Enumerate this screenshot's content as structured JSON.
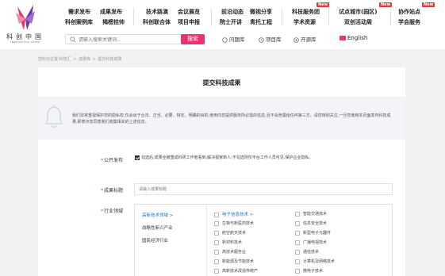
{
  "logo": {
    "cn": "科创中国",
    "en": "INNOVATION CHINA"
  },
  "nav": {
    "row1": [
      "需求发布",
      "成果发布",
      "技术路演",
      "会议展览",
      "前沿动态",
      "微视分享",
      "科技服务团",
      "试点城市(园区)",
      "协作站点"
    ],
    "row2": [
      "科创案例库",
      "揭榜挂帅",
      "科创联合体",
      "项目申报",
      "院士开讲",
      "青托工程",
      "学术资源",
      "双创活动周",
      "学会服务"
    ],
    "new_badge": "New"
  },
  "search": {
    "placeholder": "请输入搜索关键词...",
    "button": "搜索"
  },
  "quick_links": {
    "experts": "问题库",
    "projects": "项目库",
    "open": "开源库",
    "english": "English"
  },
  "breadcrumb": [
    "您所在位置:科技汇",
    ">",
    "成果库",
    ">",
    "提交科技成果"
  ],
  "page_title": "提交科技成果",
  "notice": "我们非常重视保护您的隐私权,仅会出于合法、正当、必要、特定、明确的目的,使用向您提供服务所必需的信息,且不会泄露给任何第三方。请您特别关注,一旦您使用本页面发布科技成果,即表示您同意我们收集相关的上述信息。",
  "form": {
    "public_label": "公开发布",
    "public_desc": "勾选后,成果全被重成科研工作者看到,解决视家新人;不勾选则仅平台工作人员可见,保护企业隐私。",
    "title_label": "成果标题",
    "title_placeholder": "请输入成果标题",
    "domain_label": "行业领域",
    "categories": [
      "高新技术领域 >",
      "战略性新兴产业",
      "国民经济行业"
    ],
    "subcategories_left": [
      "电子信息技术 >",
      "生物与新医药技术",
      "航空航天技术",
      "新材料技术",
      "高技术服务业",
      "新能源及节能技术",
      "高新技术改造传统产"
    ],
    "subcategories_right": [
      "智能交通技术",
      "信息安全技术",
      "新型电子元器件",
      "广播电视技术",
      "通信技术",
      "计算机及网络技术",
      "微电子技术"
    ]
  },
  "colors": {
    "accent": "#e8336e",
    "link": "#1e73c8",
    "badge": "#e4393c"
  }
}
